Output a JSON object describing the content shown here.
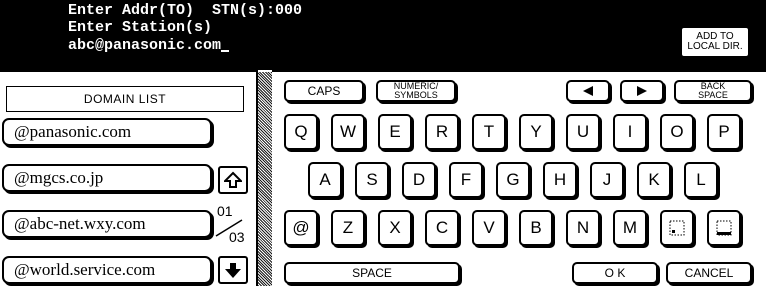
{
  "header": {
    "line1": "Enter Addr(TO)  STN(s):000",
    "line2": "Enter Station(s)",
    "line3": "abc@panasonic.com",
    "add_local_line1": "ADD TO",
    "add_local_line2": "LOCAL DIR."
  },
  "domain_list": {
    "title": "DOMAIN LIST",
    "items": [
      "@panasonic.com",
      "@mgcs.co.jp",
      "@abc-net.wxy.com",
      "@world.service.com"
    ],
    "page_current": "01",
    "page_total": "03"
  },
  "keyboard": {
    "caps": "CAPS",
    "numeric_line1": "NUMERIC/",
    "numeric_line2": "SYMBOLS",
    "back_line1": "BACK",
    "back_line2": "SPACE",
    "row1": [
      "Q",
      "W",
      "E",
      "R",
      "T",
      "Y",
      "U",
      "I",
      "O",
      "P"
    ],
    "row2": [
      "A",
      "S",
      "D",
      "F",
      "G",
      "H",
      "J",
      "K",
      "L"
    ],
    "row3": [
      "@",
      "Z",
      "X",
      "C",
      "V",
      "B",
      "N",
      "M"
    ],
    "space": "SPACE",
    "ok": "O K",
    "cancel": "CANCEL"
  }
}
